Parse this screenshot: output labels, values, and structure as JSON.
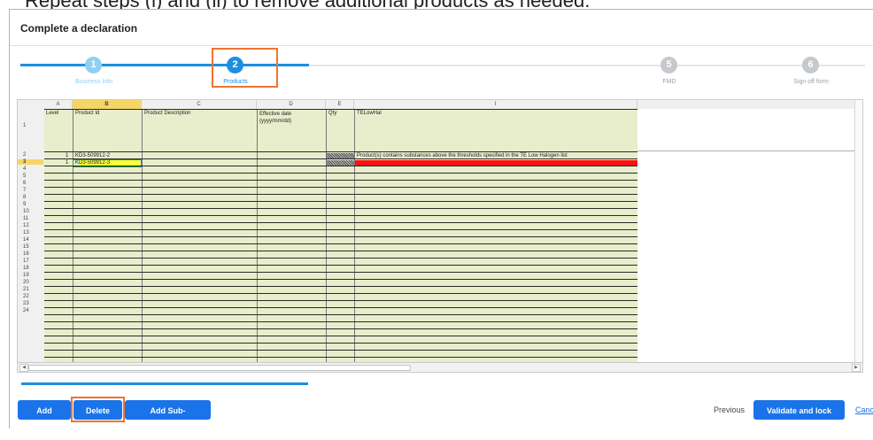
{
  "caption": "Repeat steps (i) and (ii) to remove additional products as needed.",
  "page": {
    "title": "Complete a declaration"
  },
  "steps": [
    {
      "number": "1",
      "label": "Business Info",
      "state": "done"
    },
    {
      "number": "2",
      "label": "Products",
      "state": "active"
    },
    {
      "number": "5",
      "label": "FMD",
      "state": "pending"
    },
    {
      "number": "6",
      "label": "Sign off form",
      "state": "pending"
    }
  ],
  "sheet": {
    "columns": [
      "A",
      "B",
      "C",
      "D",
      "E",
      "I"
    ],
    "selected_column": "B",
    "headers": {
      "level": "Level",
      "product_id": "Product Id",
      "product_description": "Product Description",
      "effective_date": "Effective date (yyyy/mm/dd)",
      "qty": "Qty",
      "telowhal": "TELowHal"
    },
    "row_numbers": [
      "1",
      "2",
      "3",
      "4",
      "5",
      "6",
      "7",
      "8",
      "9",
      "10",
      "11",
      "12",
      "13",
      "14",
      "15",
      "16",
      "17",
      "18",
      "19",
      "20",
      "21",
      "22",
      "23",
      "24"
    ],
    "selected_row": "3",
    "rows": [
      {
        "level": "1",
        "product_id": "KD3-509912-2",
        "telowhal": "Product(s) contains substances above the thresholds specified in the TE Low Halogen list"
      },
      {
        "level": "1",
        "product_id": "KD3-509912-3",
        "telowhal": ""
      }
    ]
  },
  "buttons": {
    "add_product": "Add Product",
    "delete_row": "Delete Row",
    "add_sub_products": "Add Sub-Products/Child",
    "previous": "Previous",
    "validate": "Validate and lock section",
    "cancel": "Canc"
  },
  "colors": {
    "accent": "#1a73e8",
    "step_done": "#8fd0f1",
    "step_active": "#1d8fe1",
    "step_pending": "#c5c8cc",
    "highlight": "#f07230",
    "error_fill": "#ff1010",
    "cell_fill": "#e8eecb"
  }
}
